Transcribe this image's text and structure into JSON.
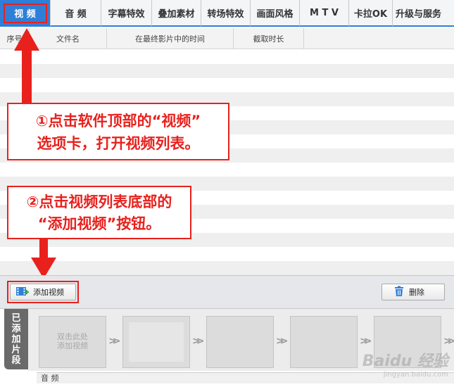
{
  "tabs": [
    {
      "label": "视 频"
    },
    {
      "label": "音 频"
    },
    {
      "label": "字幕特效"
    },
    {
      "label": "叠加素材"
    },
    {
      "label": "转场特效"
    },
    {
      "label": "画面风格"
    },
    {
      "label": "M T V"
    },
    {
      "label": "卡拉OK"
    },
    {
      "label": "升级与服务"
    }
  ],
  "columns": {
    "index": "序号",
    "filename": "文件名",
    "time_in_film": "在最终影片中的时间",
    "duration": "截取时长"
  },
  "callouts": {
    "step1_line1": "①点击软件顶部的“视频”",
    "step1_line2": "选项卡，打开视频列表。",
    "step2_line1": "②点击视频列表底部的",
    "step2_line2": "“添加视频”按钮。"
  },
  "toolbar": {
    "add_label": "添加视频",
    "delete_label": "删除"
  },
  "strip": {
    "label_chars": [
      "已",
      "添",
      "加",
      "片",
      "段"
    ],
    "placeholder_line1": "双击此处",
    "placeholder_line2": "添加视频",
    "audio_label": "音 频"
  },
  "watermark": {
    "main": "Baidu 经验",
    "sub": "jingyan.baidu.com"
  },
  "colors": {
    "accent_blue": "#2f7fd8",
    "annotation_red": "#e8211d"
  },
  "icons": {
    "add": "film-add-icon",
    "delete": "trash-icon",
    "chevron": "double-chevron-right-icon",
    "arrow": "red-arrow-icon"
  }
}
